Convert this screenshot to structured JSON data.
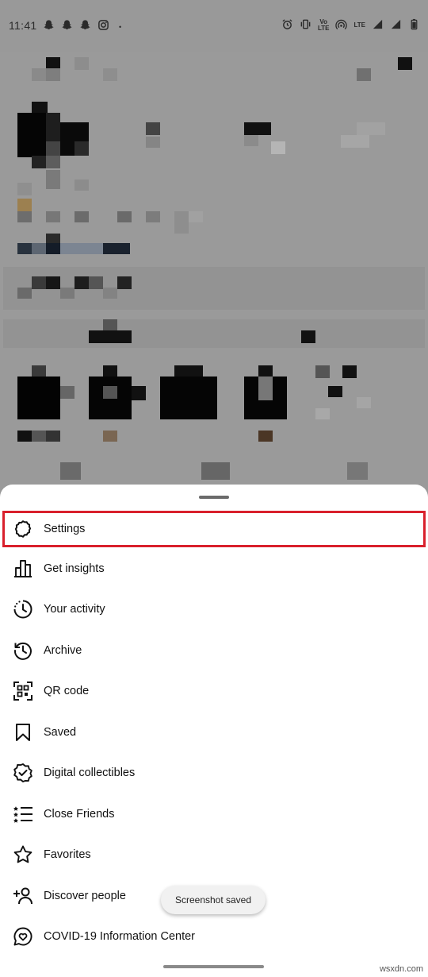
{
  "status_bar": {
    "time": "11:41",
    "network_label_top": "Vo",
    "network_label_bottom": "LTE",
    "lte_label": "LTE",
    "icons_left": [
      "snapchat-icon",
      "snapchat-icon",
      "snapchat-icon",
      "instagram-icon",
      "dot-icon"
    ],
    "icons_right": [
      "alarm-icon",
      "vibrate-icon",
      "volte-icon",
      "hotspot-icon",
      "signal-icon",
      "signal-icon",
      "battery-icon"
    ]
  },
  "menu": {
    "items": [
      {
        "label": "Settings",
        "icon": "gear-icon"
      },
      {
        "label": "Get insights",
        "icon": "bar-chart-icon"
      },
      {
        "label": "Your activity",
        "icon": "activity-clock-icon"
      },
      {
        "label": "Archive",
        "icon": "history-icon"
      },
      {
        "label": "QR code",
        "icon": "qr-code-icon"
      },
      {
        "label": "Saved",
        "icon": "bookmark-icon"
      },
      {
        "label": "Digital collectibles",
        "icon": "verified-check-icon"
      },
      {
        "label": "Close Friends",
        "icon": "close-friends-list-icon"
      },
      {
        "label": "Favorites",
        "icon": "star-icon"
      },
      {
        "label": "Discover people",
        "icon": "add-person-icon"
      },
      {
        "label": "COVID-19 Information Center",
        "icon": "heart-chat-icon"
      }
    ],
    "highlighted_item": "Settings",
    "highlight_color": "#d9202c"
  },
  "toast": {
    "text": "Screenshot saved"
  },
  "watermark": "wsxdn.com"
}
